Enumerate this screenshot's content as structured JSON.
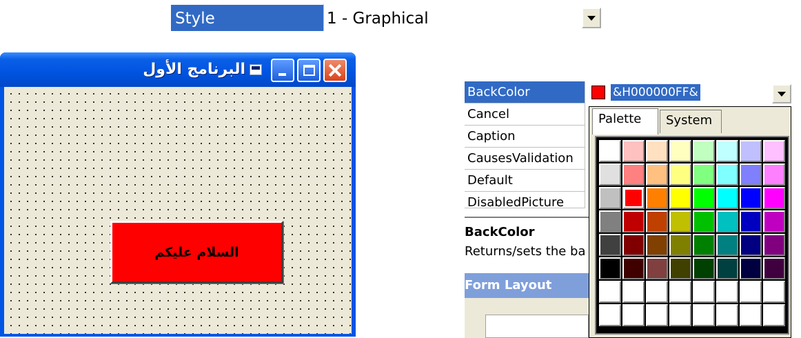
{
  "style_row": {
    "name": "Style",
    "value": "1 - Graphical"
  },
  "form": {
    "title": "البرنامج الأول",
    "button_caption": "السلام عليكم"
  },
  "properties": {
    "rows": [
      {
        "name": "BackColor",
        "value": "&H000000FF&",
        "selected": true
      },
      {
        "name": "Cancel"
      },
      {
        "name": "Caption"
      },
      {
        "name": "CausesValidation"
      },
      {
        "name": "Default"
      },
      {
        "name": "DisabledPicture"
      }
    ],
    "description_title": "BackColor",
    "description_text": "Returns/sets the ba",
    "layout_title": "Form Layout"
  },
  "palette": {
    "tabs": [
      "Palette",
      "System"
    ],
    "colors": [
      [
        "#ffffff",
        "#ffc0c0",
        "#ffe0c0",
        "#ffffc0",
        "#c0ffc0",
        "#c0ffff",
        "#c0c0ff",
        "#ffc0ff"
      ],
      [
        "#e0e0e0",
        "#ff8080",
        "#ffc080",
        "#ffff80",
        "#80ff80",
        "#80ffff",
        "#8080ff",
        "#ff80ff"
      ],
      [
        "#c0c0c0",
        "#ff0000",
        "#ff8000",
        "#ffff00",
        "#00ff00",
        "#00ffff",
        "#0000ff",
        "#ff00ff"
      ],
      [
        "#808080",
        "#c00000",
        "#c04000",
        "#c0c000",
        "#00c000",
        "#00c0c0",
        "#0000c0",
        "#c000c0"
      ],
      [
        "#404040",
        "#800000",
        "#804000",
        "#808000",
        "#008000",
        "#008080",
        "#000080",
        "#800080"
      ],
      [
        "#000000",
        "#400000",
        "#804040",
        "#404000",
        "#004000",
        "#004040",
        "#000040",
        "#400040"
      ],
      [
        "#ffffff",
        "#ffffff",
        "#ffffff",
        "#ffffff",
        "#ffffff",
        "#ffffff",
        "#ffffff",
        "#ffffff"
      ],
      [
        "#ffffff",
        "#ffffff",
        "#ffffff",
        "#ffffff",
        "#ffffff",
        "#ffffff",
        "#ffffff",
        "#ffffff"
      ]
    ],
    "selected_color": "#ff0000"
  }
}
